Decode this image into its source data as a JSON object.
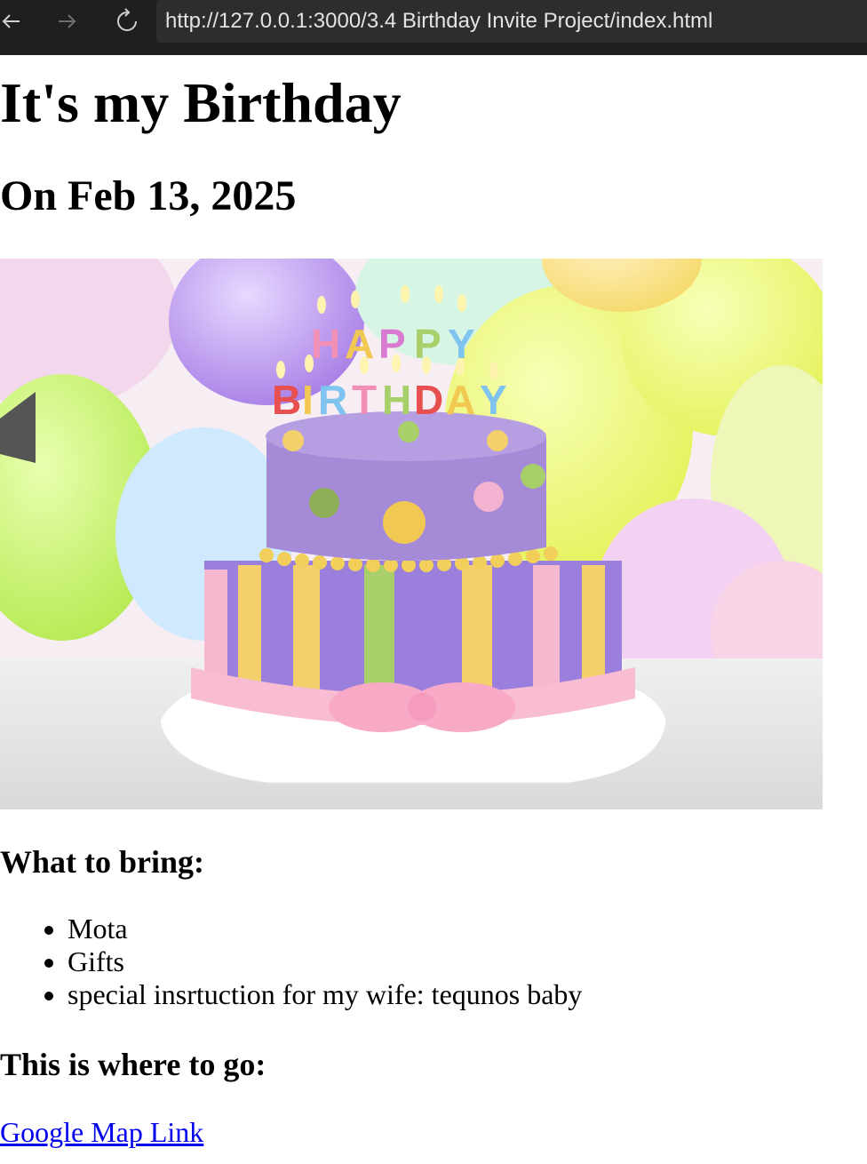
{
  "browser": {
    "url": "http://127.0.0.1:3000/3.4 Birthday Invite Project/index.html",
    "back_icon": "arrow-left-icon",
    "forward_icon": "arrow-right-icon",
    "reload_icon": "reload-icon"
  },
  "page": {
    "title": "It's my Birthday",
    "date": "On Feb 13, 2025",
    "image_alt": "HAPPY BIRTHDAY cake",
    "bring_heading": "What to bring:",
    "bring_items": [
      "Mota",
      "Gifts",
      "special insrtuction for my wife: tequnos baby"
    ],
    "where_heading": "This is where to go:",
    "map_link": "Google Map Link"
  },
  "colors": {
    "chrome_bg": "#1f1f1f",
    "url_bg": "#2d2d2d",
    "link": "#0000ee"
  }
}
